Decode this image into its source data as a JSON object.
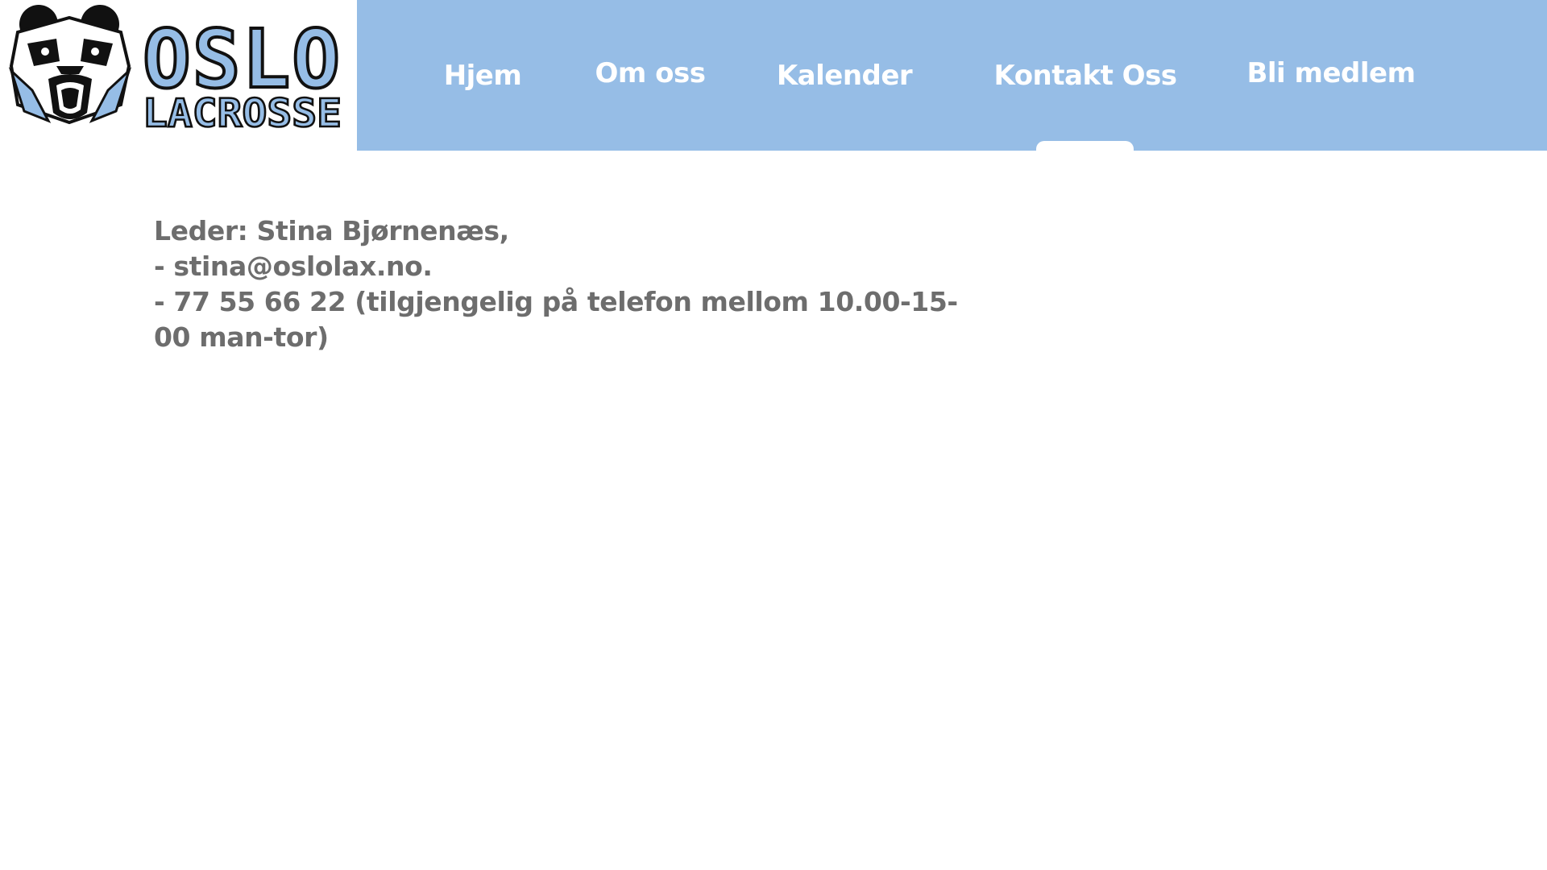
{
  "brand": {
    "line1": "OSLO",
    "line2": "LACROSSE",
    "colors": {
      "primary": "#96bde6",
      "dark": "#1a1a1a"
    }
  },
  "nav": {
    "items": [
      {
        "label": "Hjem"
      },
      {
        "label": "Om oss"
      },
      {
        "label": "Kalender"
      },
      {
        "label": "Kontakt Oss"
      },
      {
        "label": "Bli medlem"
      }
    ],
    "active_index": 3,
    "background": "#96bde6"
  },
  "contact": {
    "leader": "Leder: Stina Bjørnenæs,",
    "email": "- stina@oslolax.no.",
    "phone": "- 77 55 66 22 (tilgjengelig på telefon mellom 10.00-15-00 man-tor)"
  },
  "colors": {
    "text": "#6d6d6d"
  }
}
